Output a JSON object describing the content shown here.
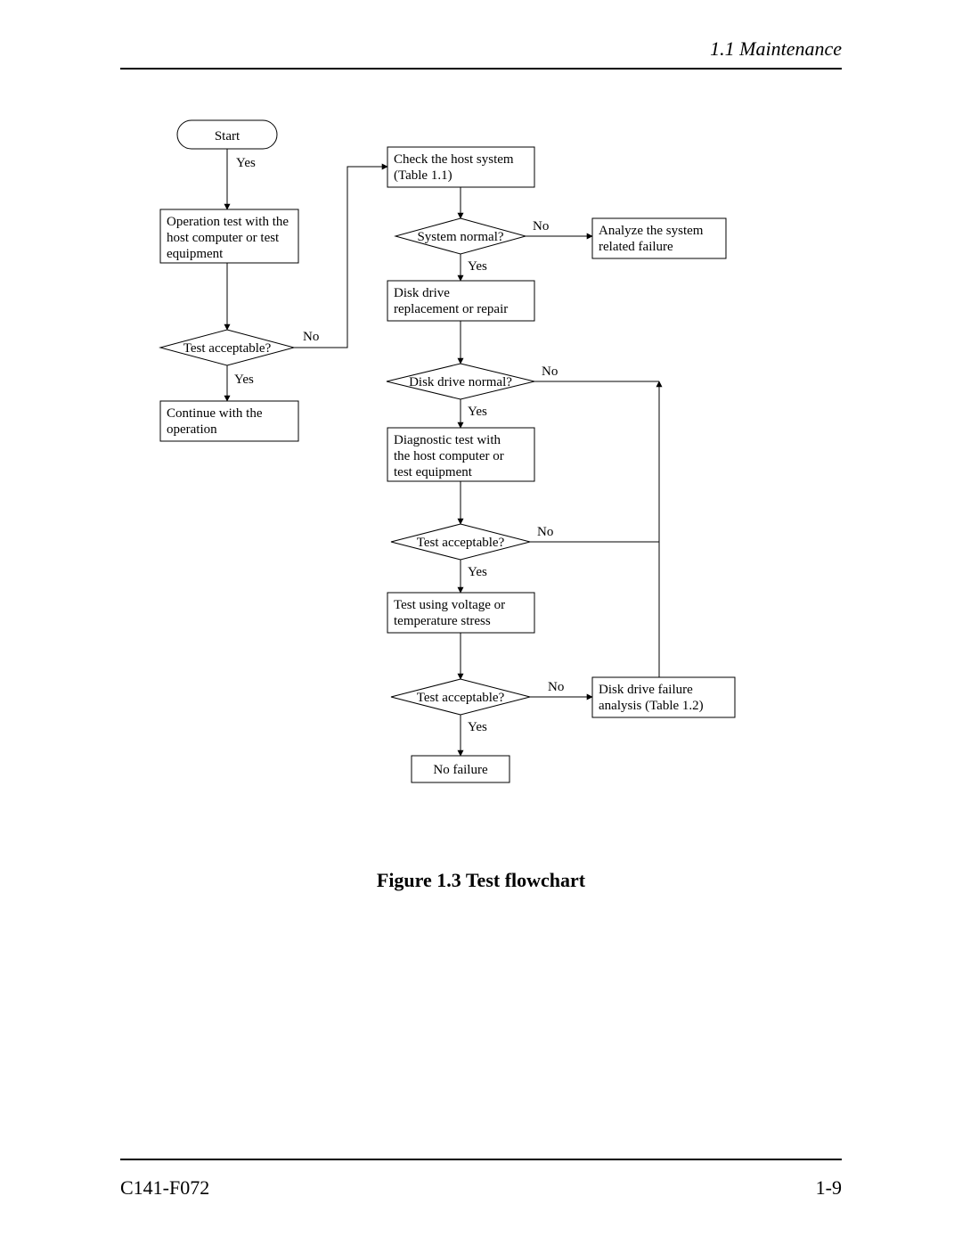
{
  "header": "1.1  Maintenance",
  "footer_left": "C141-F072",
  "footer_right": "1-9",
  "caption": "Figure 1.3  Test flowchart",
  "start": "Start",
  "yes": "Yes",
  "no": "No",
  "op_test1": "Operation test with the",
  "op_test2": "host computer or test",
  "op_test3": "equipment",
  "test_acceptable": "Test acceptable?",
  "continue1": "Continue with the",
  "continue2": "operation",
  "check_host1": "Check the host system",
  "check_host2": "(Table 1.1)",
  "system_normal": "System normal?",
  "analyze1": "Analyze the system",
  "analyze2": "related failure",
  "disk_repl1": "Disk drive",
  "disk_repl2": "replacement or repair",
  "disk_normal": "Disk drive normal?",
  "diag1": "Diagnostic test with",
  "diag2": "the host computer or",
  "diag3": "test equipment",
  "stress1": "Test using voltage or",
  "stress2": "temperature stress",
  "ddfail1": "Disk drive failure",
  "ddfail2": "analysis (Table 1.2)",
  "no_failure": "No failure"
}
